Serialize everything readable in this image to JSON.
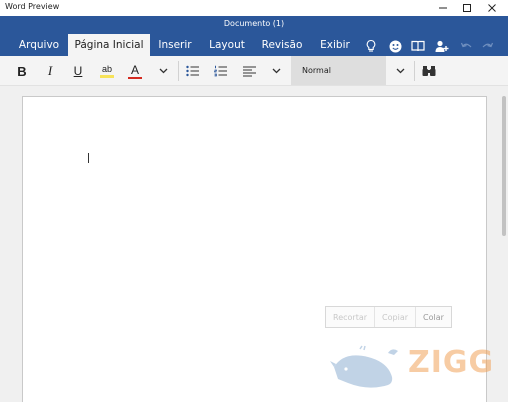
{
  "window": {
    "app_title": "Word Preview",
    "controls": {
      "minimize": "minimize-icon",
      "maximize": "maximize-icon",
      "close": "close-icon"
    }
  },
  "ribbon": {
    "doc_title": "Documento (1)",
    "tabs": [
      {
        "label": "Arquivo",
        "active": false
      },
      {
        "label": "Página Inicial",
        "active": true
      },
      {
        "label": "Inserir",
        "active": false
      },
      {
        "label": "Layout",
        "active": false
      },
      {
        "label": "Revisão",
        "active": false
      },
      {
        "label": "Exibir",
        "active": false
      }
    ],
    "icons": [
      "lightbulb-icon",
      "smiley-icon",
      "book-icon",
      "share-person-icon",
      "undo-icon",
      "redo-icon"
    ]
  },
  "toolbar": {
    "bold": "B",
    "italic": "I",
    "underline": "U",
    "highlight": "ab",
    "font_color": "A",
    "style_value": "Normal",
    "icons": [
      "bullets-icon",
      "numbering-icon",
      "align-left-icon",
      "chevron-down-icon",
      "find-binoculars-icon"
    ]
  },
  "context_menu": {
    "items": [
      "Recortar",
      "Copiar",
      "Colar"
    ]
  },
  "watermark": {
    "text": "ZIGG"
  },
  "colors": {
    "ribbon_blue": "#2b579a",
    "highlight_yellow": "#f7e35a",
    "font_color_red": "#d42a20",
    "watermark_orange": "#f1a35a",
    "watermark_blue": "#8fb0d3"
  }
}
